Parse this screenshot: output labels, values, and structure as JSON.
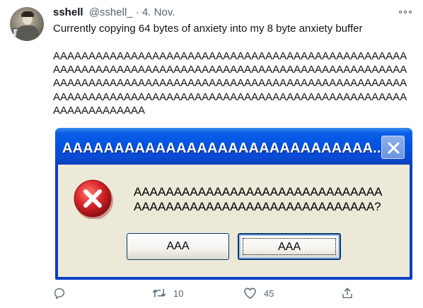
{
  "tweet": {
    "author_name": "sshell",
    "handle": "@sshell_",
    "separator": "·",
    "date": "4. Nov.",
    "text": "Currently copying 64 bytes of anxiety into my 8 byte anxiety buffer",
    "scream": "AAAAAAAAAAAAAAAAAAAAAAAAAAAAAAAAAAAAAAAAAAAAAAAAAAAAAAAAAAAAAAAAAAAAAAAAAAAAAAAAAAAAAAAAAAAAAAAAAAAAAAAAAAAAAAAAAAAAAAAAAAAAAAAAAAAAAAAAAAAAAAAAAAAAAAAAAAAAAAAAAAAAAAAAAAAAAAAAAAAAAAAAAAAAAAAAAAAAAAAAAAAAAAAAAAAAA"
  },
  "dialog": {
    "title": "AAAAAAAAAAAAAAAAAAAAAAAAAAAAAA...",
    "message_line1": "AAAAAAAAAAAAAAAAAAAAAAAAAAAAAAA",
    "message_line2": "AAAAAAAAAAAAAAAAAAAAAAAAAAAAAA?",
    "button_left_label": "AAA",
    "button_right_label": "AAA",
    "title_bar_color": "#0052e0",
    "error_icon_color": "#d8262b"
  },
  "actions": {
    "reply_count": "",
    "retweet_count": "10",
    "like_count": "45"
  },
  "icons": {
    "reply": "reply-icon",
    "retweet": "retweet-icon",
    "like": "heart-icon",
    "share": "share-icon",
    "more": "more-icon",
    "close": "close-icon",
    "error": "error-icon"
  }
}
